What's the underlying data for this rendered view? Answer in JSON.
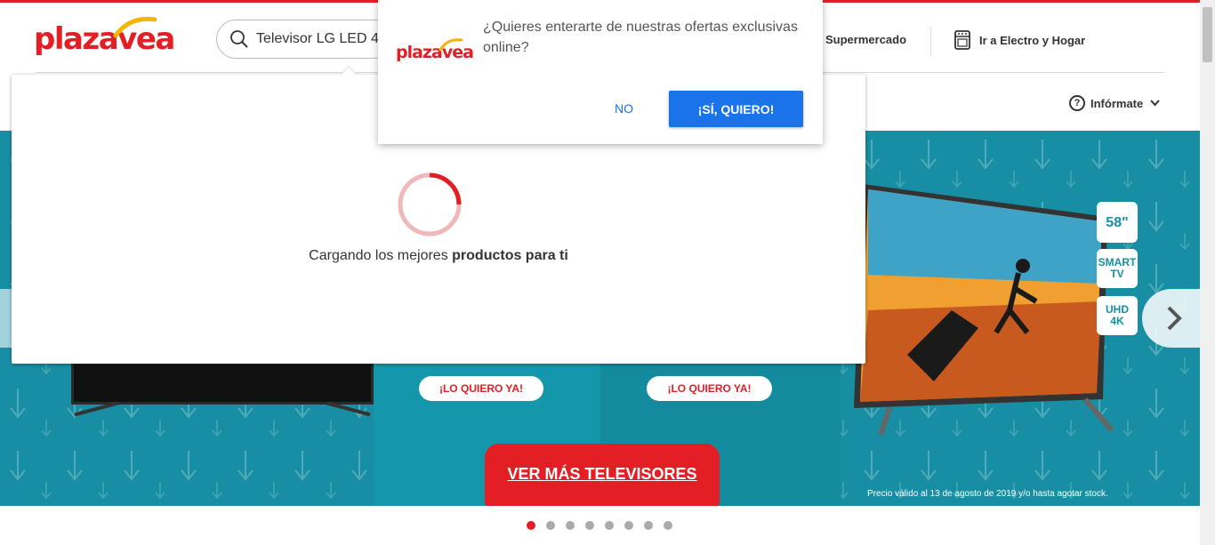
{
  "brand": {
    "logo_text": "plazavea",
    "accent": "#e31e24"
  },
  "header": {
    "search_value": "Televisor LG LED 4",
    "nav_super": "Supermercado",
    "nav_electro": "Ir a Electro y Hogar",
    "informate": "Infórmate"
  },
  "notification": {
    "logo_text": "plazavea",
    "message": "¿Quieres enterarte de nuestras ofertas exclusivas online?",
    "no_label": "NO",
    "yes_label": "¡SÍ, QUIERO!",
    "button_color": "#1a73e8"
  },
  "loader": {
    "text_prefix": "Cargando los mejores ",
    "text_bold": "productos para ti"
  },
  "banner": {
    "cta1": "¡LO QUIERO YA!",
    "cta2": "¡LO QUIERO YA!",
    "main_cta": "VER MÁS TELEVISORES",
    "badge_size": "58\"",
    "badge_smart_line1": "SMART",
    "badge_smart_line2": "TV",
    "badge_uhd_line1": "UHD",
    "badge_uhd_line2": "4K",
    "disclaimer": "Precio válido al 13 de agosto de 2019 y/o hasta agotar stock.",
    "background": "#178ea3"
  },
  "carousel": {
    "dot_count": 8,
    "active_index": 0
  }
}
